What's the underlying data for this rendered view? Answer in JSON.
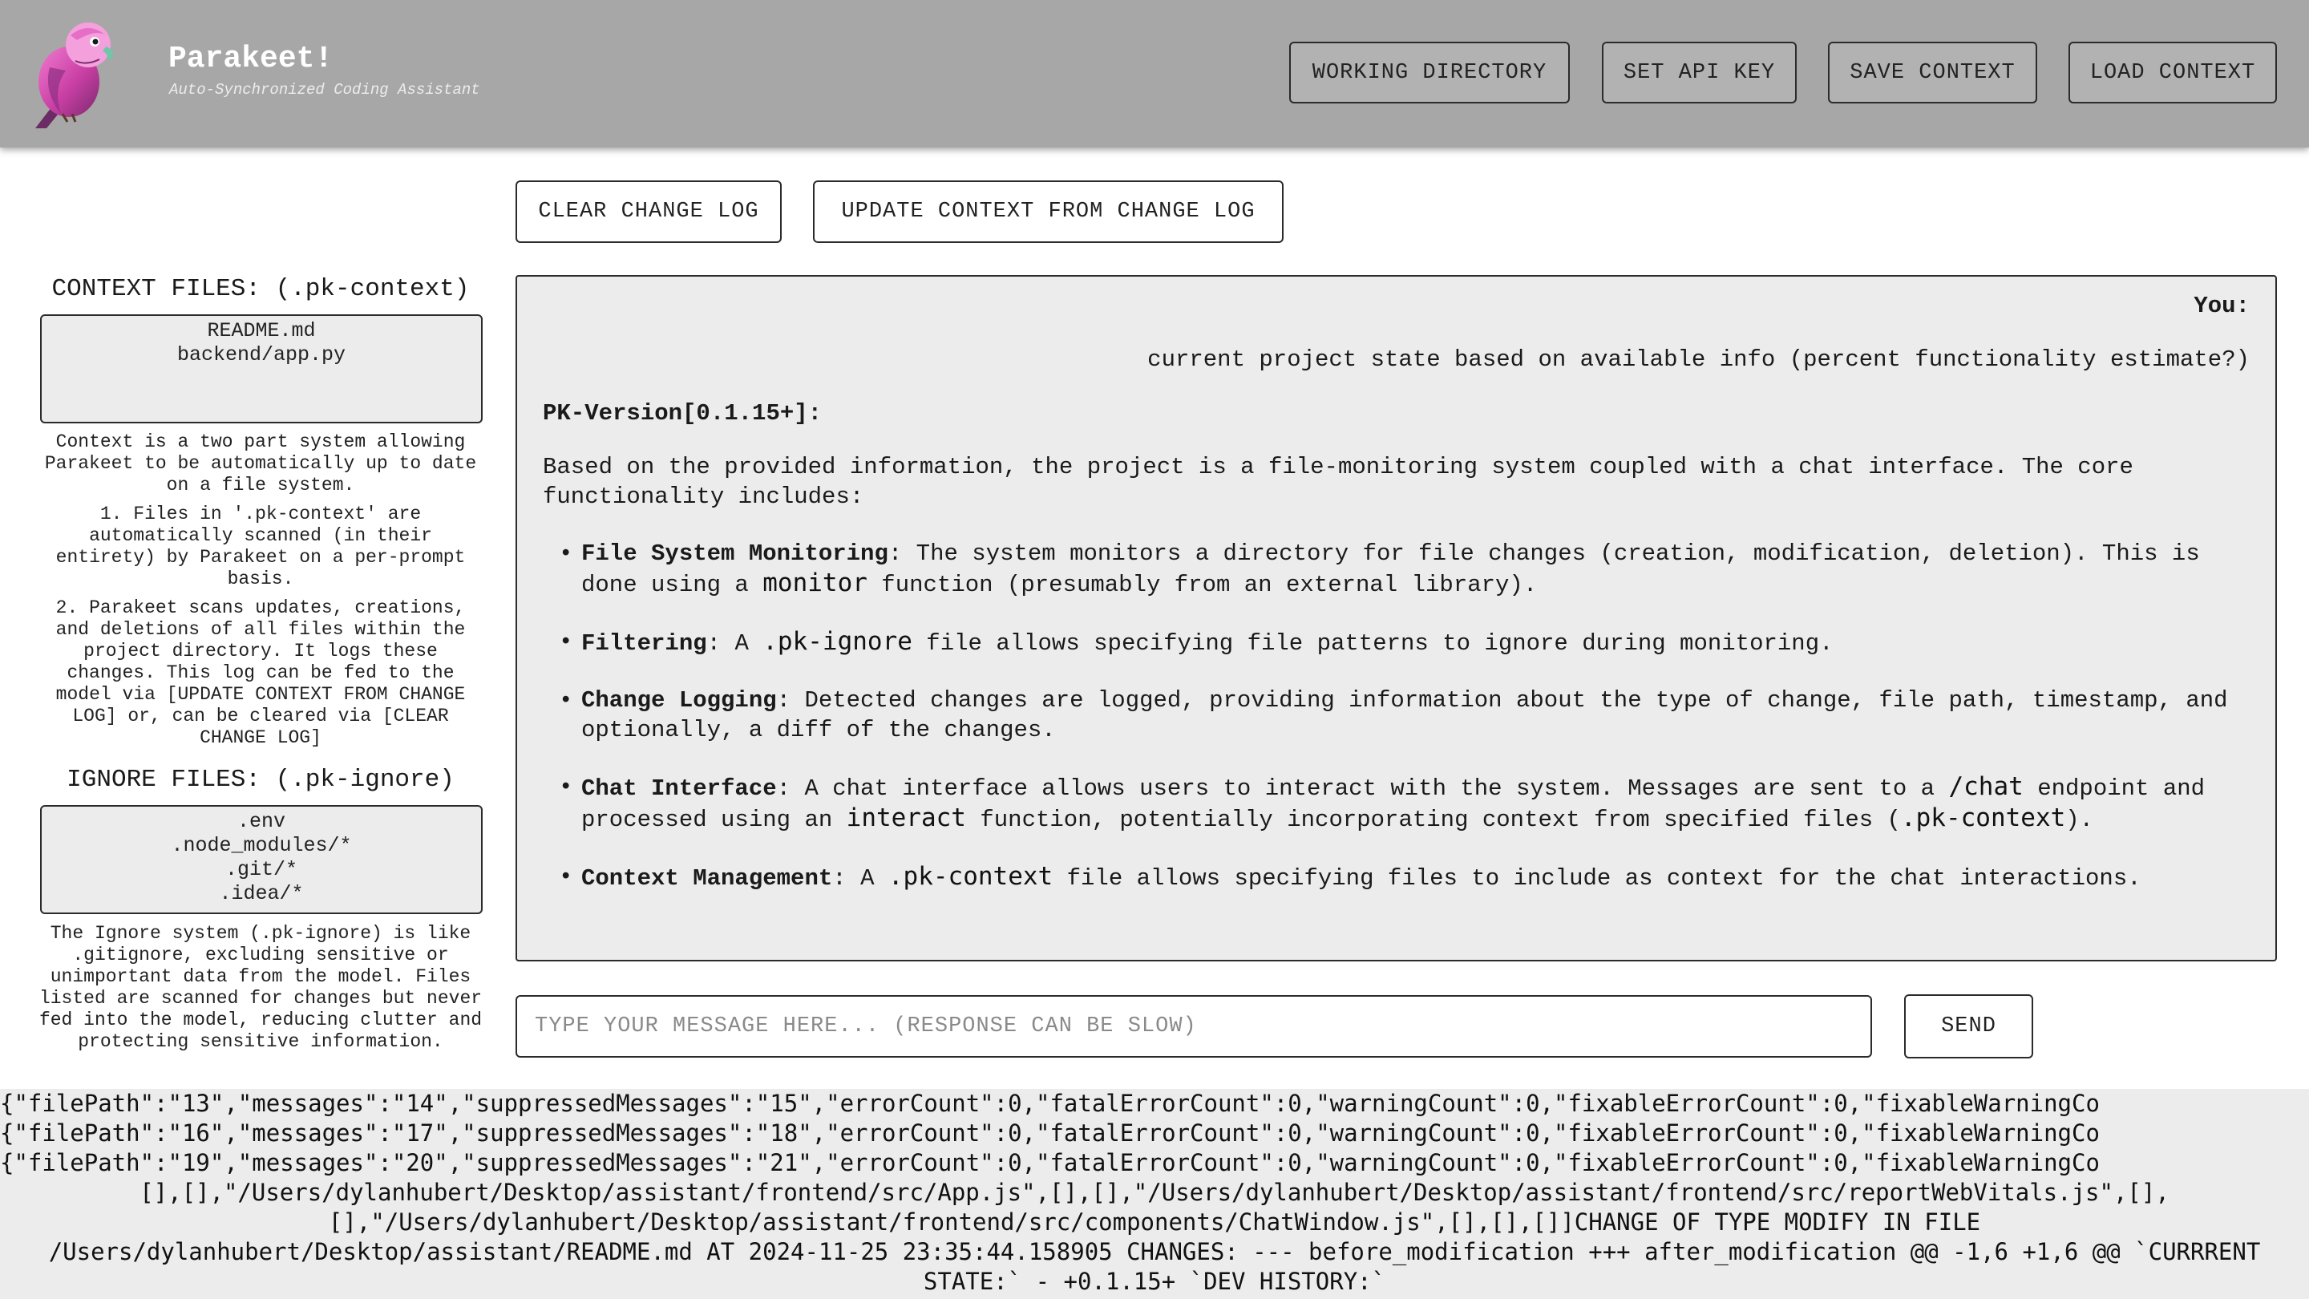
{
  "header": {
    "title": "Parakeet!",
    "subtitle": "Auto-Synchronized Coding Assistant",
    "buttons": {
      "working_directory": "WORKING DIRECTORY",
      "set_api_key": "SET API KEY",
      "save_context": "SAVE CONTEXT",
      "load_context": "LOAD CONTEXT"
    }
  },
  "toolbar": {
    "clear_change_log": "CLEAR CHANGE LOG",
    "update_context": "UPDATE CONTEXT FROM CHANGE LOG"
  },
  "sidebar": {
    "context_title": "CONTEXT FILES: (.pk-context)",
    "context_files": [
      "README.md",
      "backend/app.py"
    ],
    "context_help": [
      "Context is a two part system allowing Parakeet to be automatically up to date on a file system.",
      "1. Files in '.pk-context' are automatically scanned (in their entirety) by Parakeet on a per-prompt basis.",
      "2. Parakeet scans updates, creations, and deletions of all files within the project directory. It logs these changes. This log can be fed to the model via [UPDATE CONTEXT FROM CHANGE LOG] or, can be cleared via [CLEAR CHANGE LOG]"
    ],
    "ignore_title": "IGNORE FILES: (.pk-ignore)",
    "ignore_files": [
      ".env",
      ".node_modules/*",
      ".git/*",
      ".idea/*"
    ],
    "ignore_help": "The Ignore system (.pk-ignore) is like .gitignore, excluding sensitive or unimportant data from the model. Files listed are scanned for changes but never fed into the model, reducing clutter and protecting sensitive information."
  },
  "chat": {
    "user_label": "You:",
    "user_message": "current project state based on available info (percent functionality estimate?)",
    "version_label": "PK-Version[0.1.15+]:",
    "intro": "Based on the provided information, the project is a file-monitoring system coupled with a chat interface. The core functionality includes:",
    "items": [
      {
        "label": "File System Monitoring",
        "a": ": The system monitors a directory for file changes (creation, modification, deletion). This is done using a ",
        "code": "monitor",
        "b": " function (presumably from an external library)."
      },
      {
        "label": "Filtering",
        "a": ": A ",
        "code": ".pk-ignore",
        "b": " file allows specifying file patterns to ignore during monitoring."
      },
      {
        "label": "Change Logging",
        "text": ": Detected changes are logged, providing information about the type of change, file path, timestamp, and optionally, a diff of the changes."
      },
      {
        "label": "Chat Interface",
        "a": ": A chat interface allows users to interact with the system. Messages are sent to a ",
        "code1": "/chat",
        "b": " endpoint and processed using an ",
        "code2": "interact",
        "c": " function, potentially incorporating context from specified files (",
        "code3": ".pk-context",
        "d": ")."
      },
      {
        "label": "Context Management",
        "a": ": A ",
        "code": ".pk-context",
        "b": " file allows specifying files to include as context for the chat interactions."
      }
    ]
  },
  "input": {
    "placeholder": "TYPE YOUR MESSAGE HERE... (RESPONSE CAN BE SLOW)",
    "send_label": "SEND"
  },
  "log": {
    "lines": [
      "{\"filePath\":\"13\",\"messages\":\"14\",\"suppressedMessages\":\"15\",\"errorCount\":0,\"fatalErrorCount\":0,\"warningCount\":0,\"fixableErrorCount\":0,\"fixableWarningCo",
      "{\"filePath\":\"16\",\"messages\":\"17\",\"suppressedMessages\":\"18\",\"errorCount\":0,\"fatalErrorCount\":0,\"warningCount\":0,\"fixableErrorCount\":0,\"fixableWarningCo",
      "{\"filePath\":\"19\",\"messages\":\"20\",\"suppressedMessages\":\"21\",\"errorCount\":0,\"fatalErrorCount\":0,\"warningCount\":0,\"fixableErrorCount\":0,\"fixableWarningCo"
    ],
    "tail": "[],[],\"/Users/dylanhubert/Desktop/assistant/frontend/src/App.js\",[],[],\"/Users/dylanhubert/Desktop/assistant/frontend/src/reportWebVitals.js\",[], [],\"/Users/dylanhubert/Desktop/assistant/frontend/src/components/ChatWindow.js\",[],[],[]]CHANGE OF TYPE MODIFY IN FILE /Users/dylanhubert/Desktop/assistant/README.md AT 2024-11-25 23:35:44.158905 CHANGES: --- before_modification +++ after_modification @@ -1,6 +1,6 @@ `CURRRENT STATE:` - +0.1.15+ `DEV HISTORY:`"
  }
}
